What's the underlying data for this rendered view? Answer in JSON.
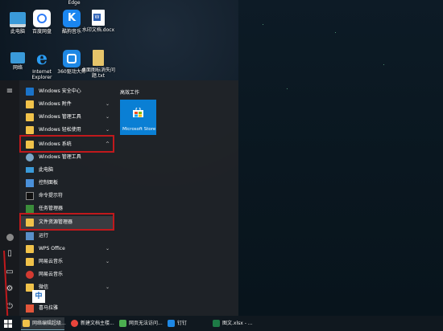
{
  "desktop": {
    "icons": [
      {
        "label": "此电脑",
        "icon": "this-pc-icon"
      },
      {
        "label": "百度网盘",
        "icon": "baidu-netdisk-icon"
      },
      {
        "label": "酷狗音乐",
        "icon": "kugou-music-icon"
      },
      {
        "label": "水印文档.docx",
        "icon": "word-doc-icon"
      },
      {
        "label": "网络",
        "icon": "network-icon"
      },
      {
        "label": "Internet Explorer",
        "icon": "ie-icon"
      },
      {
        "label": "360驱动大师",
        "icon": "driver-master-icon"
      },
      {
        "label": "桌面图标消失问题.txt",
        "icon": "text-file-icon"
      },
      {
        "label": "Edge",
        "icon": "edge-icon"
      }
    ]
  },
  "start_menu": {
    "tiles_header": "高效工作",
    "tile_store": "Microsoft Store",
    "apps": [
      {
        "label": "Windows 安全中心",
        "chev": ""
      },
      {
        "label": "Windows 附件",
        "chev": "⌄"
      },
      {
        "label": "Windows 管理工具",
        "chev": "⌄"
      },
      {
        "label": "Windows 轻松使用",
        "chev": "⌄"
      },
      {
        "label": "Windows 系统",
        "chev": "^"
      },
      {
        "label": "Windows 管理工具",
        "chev": ""
      },
      {
        "label": "此电脑",
        "chev": ""
      },
      {
        "label": "控制面板",
        "chev": ""
      },
      {
        "label": "命令提示符",
        "chev": ""
      },
      {
        "label": "任务管理器",
        "chev": ""
      },
      {
        "label": "文件资源管理器",
        "chev": ""
      },
      {
        "label": "运行",
        "chev": ""
      },
      {
        "label": "WPS Office",
        "chev": "⌄"
      },
      {
        "label": "网易云音乐",
        "chev": "⌄"
      },
      {
        "label": "网易云音乐",
        "chev": ""
      },
      {
        "label": "微信",
        "chev": "⌄"
      },
      {
        "label": "喜马拉雅",
        "chev": ""
      }
    ]
  },
  "ime": "中",
  "taskbar": {
    "items": [
      {
        "label": "网络编辑超级..."
      },
      {
        "label": "新建文档主楼..."
      },
      {
        "label": "网页无法访问..."
      },
      {
        "label": "钉钉"
      },
      {
        "label": "图文.xlsx - ..."
      }
    ]
  },
  "colors": {
    "highlight": "#c0191c",
    "tile": "#0a7fd4",
    "folder": "#f0c24a"
  }
}
